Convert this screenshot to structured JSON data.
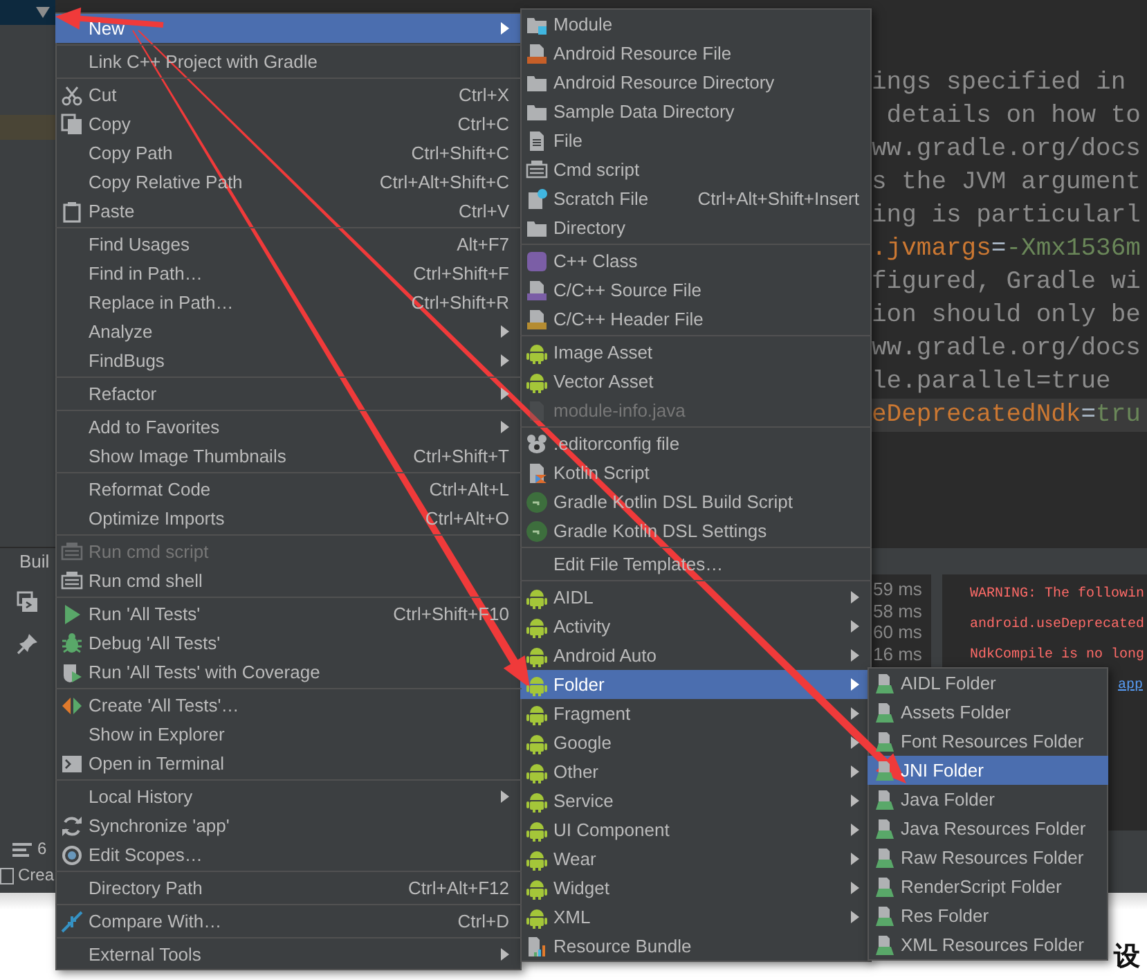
{
  "project_panel": {
    "build_tab": "Buil",
    "status_count": "6",
    "status_text": "Crea"
  },
  "editor": {
    "lines": [
      {
        "highlighted": false,
        "segments": [
          {
            "kind": "comment",
            "text": "ings specified in"
          }
        ]
      },
      {
        "highlighted": false,
        "segments": [
          {
            "kind": "comment",
            "text": " details on how to"
          }
        ]
      },
      {
        "highlighted": false,
        "segments": [
          {
            "kind": "comment",
            "text": "ww.gradle.org/docs"
          }
        ]
      },
      {
        "highlighted": false,
        "segments": [
          {
            "kind": "comment",
            "text": "s the JVM argument"
          }
        ]
      },
      {
        "highlighted": false,
        "segments": [
          {
            "kind": "comment",
            "text": "ing is particularl"
          }
        ]
      },
      {
        "highlighted": false,
        "segments": [
          {
            "kind": "key",
            "text": ".jvmargs"
          },
          {
            "kind": "op",
            "text": "="
          },
          {
            "kind": "value",
            "text": "-Xmx1536m"
          }
        ]
      },
      {
        "highlighted": false,
        "segments": [
          {
            "kind": "comment",
            "text": "figured, Gradle wi"
          }
        ]
      },
      {
        "highlighted": false,
        "segments": [
          {
            "kind": "comment",
            "text": "ion should only be"
          }
        ]
      },
      {
        "highlighted": false,
        "segments": [
          {
            "kind": "comment",
            "text": "ww.gradle.org/docs"
          }
        ]
      },
      {
        "highlighted": false,
        "segments": [
          {
            "kind": "comment",
            "text": "le.parallel=true"
          }
        ]
      },
      {
        "highlighted": true,
        "segments": [
          {
            "kind": "key",
            "text": "eDeprecatedNdk"
          },
          {
            "kind": "op",
            "text": "="
          },
          {
            "kind": "value",
            "text": "tru"
          }
        ]
      }
    ]
  },
  "build_output": {
    "timings": [
      "59 ms",
      "58 ms",
      "60 ms",
      "16 ms"
    ],
    "lines": [
      {
        "kind": "warning",
        "text": "WARNING: The followin"
      },
      {
        "kind": "warning",
        "text": "android.useDeprecated"
      },
      {
        "kind": "warning",
        "text": "NdkCompile is no long"
      },
      {
        "kind": "link",
        "text": "app"
      }
    ]
  },
  "page_text": "设",
  "menus": [
    {
      "groups": [
        [
          {
            "label": "New",
            "submenu": true,
            "selected": true,
            "disabled": false
          }
        ],
        [
          {
            "label": "Link C++ Project with Gradle",
            "submenu": false,
            "selected": false,
            "disabled": false
          }
        ],
        [
          {
            "label": "Cut",
            "shortcut": "Ctrl+X",
            "submenu": false,
            "selected": false,
            "disabled": false
          },
          {
            "label": "Copy",
            "shortcut": "Ctrl+C",
            "submenu": false,
            "selected": false,
            "disabled": false
          },
          {
            "label": "Copy Path",
            "shortcut": "Ctrl+Shift+C",
            "submenu": false,
            "selected": false,
            "disabled": false
          },
          {
            "label": "Copy Relative Path",
            "shortcut": "Ctrl+Alt+Shift+C",
            "submenu": false,
            "selected": false,
            "disabled": false
          },
          {
            "label": "Paste",
            "shortcut": "Ctrl+V",
            "submenu": false,
            "selected": false,
            "disabled": false
          }
        ],
        [
          {
            "label": "Find Usages",
            "shortcut": "Alt+F7",
            "submenu": false,
            "selected": false,
            "disabled": false
          },
          {
            "label": "Find in Path…",
            "shortcut": "Ctrl+Shift+F",
            "submenu": false,
            "selected": false,
            "disabled": false
          },
          {
            "label": "Replace in Path…",
            "shortcut": "Ctrl+Shift+R",
            "submenu": false,
            "selected": false,
            "disabled": false
          },
          {
            "label": "Analyze",
            "submenu": true,
            "selected": false,
            "disabled": false
          },
          {
            "label": "FindBugs",
            "submenu": true,
            "selected": false,
            "disabled": false
          }
        ],
        [
          {
            "label": "Refactor",
            "submenu": true,
            "selected": false,
            "disabled": false
          }
        ],
        [
          {
            "label": "Add to Favorites",
            "submenu": true,
            "selected": false,
            "disabled": false
          },
          {
            "label": "Show Image Thumbnails",
            "shortcut": "Ctrl+Shift+T",
            "submenu": false,
            "selected": false,
            "disabled": false
          }
        ],
        [
          {
            "label": "Reformat Code",
            "shortcut": "Ctrl+Alt+L",
            "submenu": false,
            "selected": false,
            "disabled": false
          },
          {
            "label": "Optimize Imports",
            "shortcut": "Ctrl+Alt+O",
            "submenu": false,
            "selected": false,
            "disabled": false
          }
        ],
        [
          {
            "label": "Run cmd script",
            "submenu": false,
            "selected": false,
            "disabled": true
          },
          {
            "label": "Run cmd shell",
            "submenu": false,
            "selected": false,
            "disabled": false
          }
        ],
        [
          {
            "label": "Run 'All Tests'",
            "shortcut": "Ctrl+Shift+F10",
            "submenu": false,
            "selected": false,
            "disabled": false
          },
          {
            "label": "Debug 'All Tests'",
            "submenu": false,
            "selected": false,
            "disabled": false
          },
          {
            "label": "Run 'All Tests' with Coverage",
            "submenu": false,
            "selected": false,
            "disabled": false
          }
        ],
        [
          {
            "label": "Create 'All Tests'…",
            "submenu": false,
            "selected": false,
            "disabled": false
          },
          {
            "label": "Show in Explorer",
            "submenu": false,
            "selected": false,
            "disabled": false
          },
          {
            "label": "Open in Terminal",
            "submenu": false,
            "selected": false,
            "disabled": false
          }
        ],
        [
          {
            "label": "Local History",
            "submenu": true,
            "selected": false,
            "disabled": false
          },
          {
            "label": "Synchronize 'app'",
            "submenu": false,
            "selected": false,
            "disabled": false
          },
          {
            "label": "Edit Scopes…",
            "submenu": false,
            "selected": false,
            "disabled": false
          }
        ],
        [
          {
            "label": "Directory Path",
            "shortcut": "Ctrl+Alt+F12",
            "submenu": false,
            "selected": false,
            "disabled": false
          }
        ],
        [
          {
            "label": "Compare With…",
            "shortcut": "Ctrl+D",
            "submenu": false,
            "selected": false,
            "disabled": false
          }
        ],
        [
          {
            "label": "External Tools",
            "submenu": true,
            "selected": false,
            "disabled": false
          }
        ]
      ]
    },
    {
      "groups": [
        [
          {
            "label": "Module",
            "submenu": false,
            "selected": false,
            "disabled": false
          },
          {
            "label": "Android Resource File",
            "submenu": false,
            "selected": false,
            "disabled": false
          },
          {
            "label": "Android Resource Directory",
            "submenu": false,
            "selected": false,
            "disabled": false
          },
          {
            "label": "Sample Data Directory",
            "submenu": false,
            "selected": false,
            "disabled": false
          },
          {
            "label": "File",
            "submenu": false,
            "selected": false,
            "disabled": false
          },
          {
            "label": "Cmd script",
            "submenu": false,
            "selected": false,
            "disabled": false
          },
          {
            "label": "Scratch File",
            "shortcut": "Ctrl+Alt+Shift+Insert",
            "submenu": false,
            "selected": false,
            "disabled": false
          },
          {
            "label": "Directory",
            "submenu": false,
            "selected": false,
            "disabled": false
          }
        ],
        [
          {
            "label": "C++ Class",
            "submenu": false,
            "selected": false,
            "disabled": false
          },
          {
            "label": "C/C++ Source File",
            "submenu": false,
            "selected": false,
            "disabled": false
          },
          {
            "label": "C/C++ Header File",
            "submenu": false,
            "selected": false,
            "disabled": false
          }
        ],
        [
          {
            "label": "Image Asset",
            "submenu": false,
            "selected": false,
            "disabled": false
          },
          {
            "label": "Vector Asset",
            "submenu": false,
            "selected": false,
            "disabled": false
          },
          {
            "label": "module-info.java",
            "submenu": false,
            "selected": false,
            "disabled": true
          }
        ],
        [
          {
            "label": ".editorconfig file",
            "submenu": false,
            "selected": false,
            "disabled": false
          },
          {
            "label": "Kotlin Script",
            "submenu": false,
            "selected": false,
            "disabled": false
          },
          {
            "label": "Gradle Kotlin DSL Build Script",
            "submenu": false,
            "selected": false,
            "disabled": false
          },
          {
            "label": "Gradle Kotlin DSL Settings",
            "submenu": false,
            "selected": false,
            "disabled": false
          }
        ],
        [
          {
            "label": "Edit File Templates…",
            "submenu": false,
            "selected": false,
            "disabled": false
          }
        ],
        [
          {
            "label": "AIDL",
            "submenu": true,
            "selected": false,
            "disabled": false
          },
          {
            "label": "Activity",
            "submenu": true,
            "selected": false,
            "disabled": false
          },
          {
            "label": "Android Auto",
            "submenu": true,
            "selected": false,
            "disabled": false
          },
          {
            "label": "Folder",
            "submenu": true,
            "selected": true,
            "disabled": false
          },
          {
            "label": "Fragment",
            "submenu": true,
            "selected": false,
            "disabled": false
          },
          {
            "label": "Google",
            "submenu": true,
            "selected": false,
            "disabled": false
          },
          {
            "label": "Other",
            "submenu": true,
            "selected": false,
            "disabled": false
          },
          {
            "label": "Service",
            "submenu": true,
            "selected": false,
            "disabled": false
          },
          {
            "label": "UI Component",
            "submenu": true,
            "selected": false,
            "disabled": false
          },
          {
            "label": "Wear",
            "submenu": true,
            "selected": false,
            "disabled": false
          },
          {
            "label": "Widget",
            "submenu": true,
            "selected": false,
            "disabled": false
          },
          {
            "label": "XML",
            "submenu": true,
            "selected": false,
            "disabled": false
          },
          {
            "label": "Resource Bundle",
            "submenu": false,
            "selected": false,
            "disabled": false
          }
        ]
      ]
    },
    {
      "groups": [
        [
          {
            "label": "AIDL Folder",
            "submenu": false,
            "selected": false,
            "disabled": false
          },
          {
            "label": "Assets Folder",
            "submenu": false,
            "selected": false,
            "disabled": false
          },
          {
            "label": "Font Resources Folder",
            "submenu": false,
            "selected": false,
            "disabled": false
          },
          {
            "label": "JNI Folder",
            "submenu": false,
            "selected": true,
            "disabled": false
          },
          {
            "label": "Java Folder",
            "submenu": false,
            "selected": false,
            "disabled": false
          },
          {
            "label": "Java Resources Folder",
            "submenu": false,
            "selected": false,
            "disabled": false
          },
          {
            "label": "Raw Resources Folder",
            "submenu": false,
            "selected": false,
            "disabled": false
          },
          {
            "label": "RenderScript Folder",
            "submenu": false,
            "selected": false,
            "disabled": false
          },
          {
            "label": "Res Folder",
            "submenu": false,
            "selected": false,
            "disabled": false
          },
          {
            "label": "XML Resources Folder",
            "submenu": false,
            "selected": false,
            "disabled": false
          }
        ]
      ]
    }
  ]
}
